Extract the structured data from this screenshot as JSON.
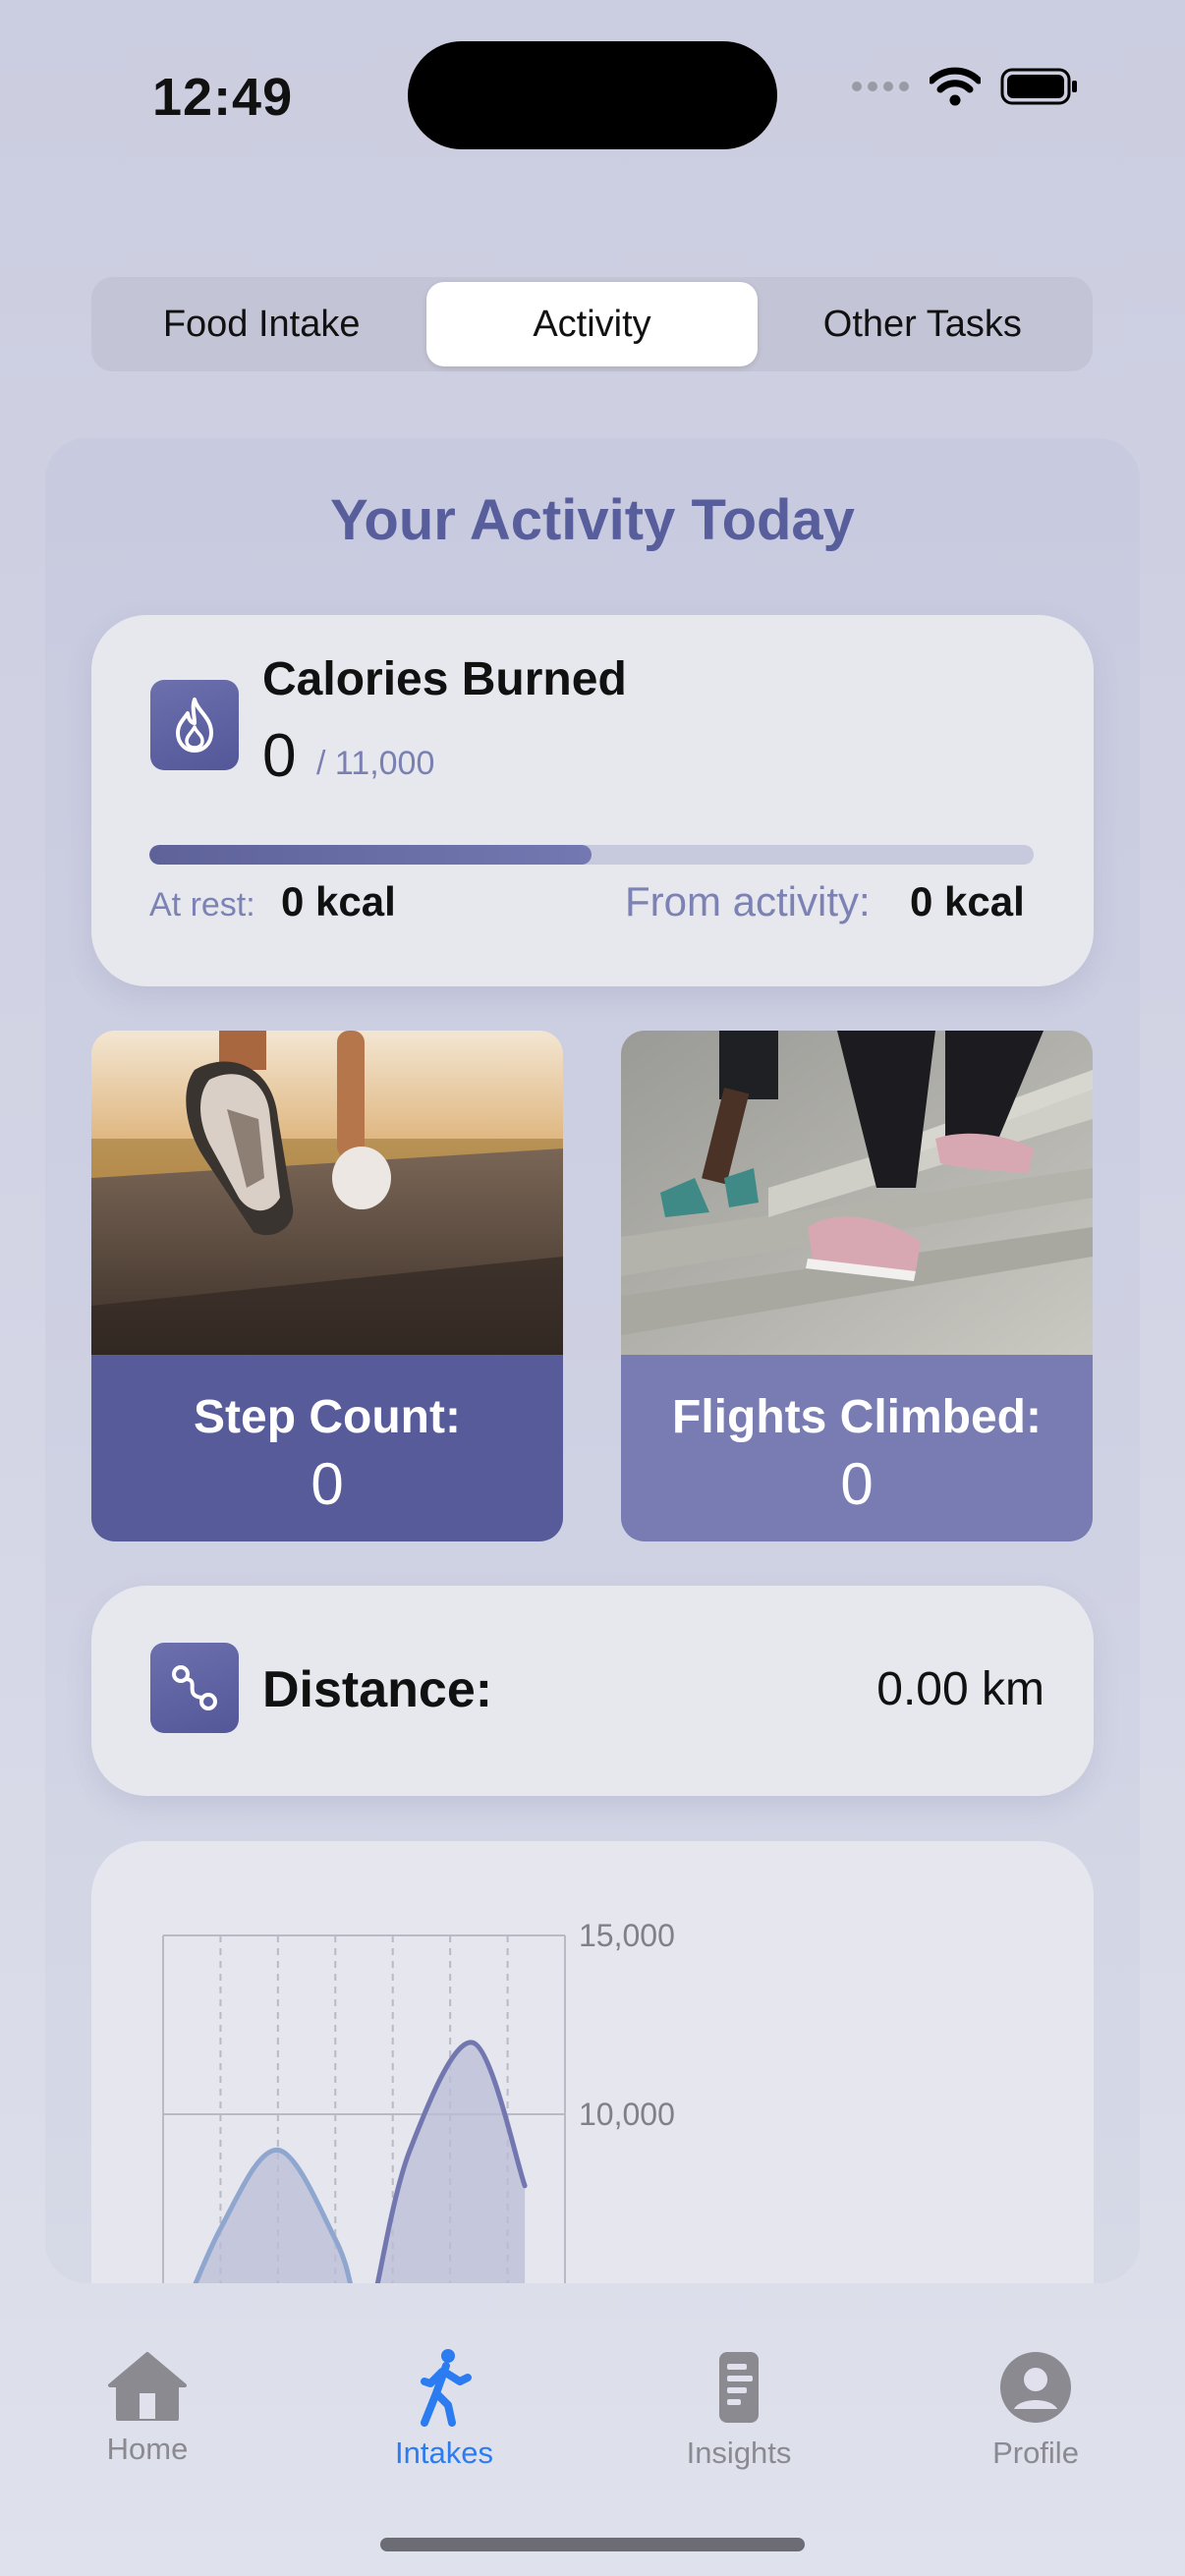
{
  "status_bar": {
    "time": "12:49"
  },
  "segments": [
    {
      "label": "Food Intake",
      "active": false
    },
    {
      "label": "Activity",
      "active": true
    },
    {
      "label": "Other Tasks",
      "active": false
    }
  ],
  "panel": {
    "title": "Your Activity Today"
  },
  "calories": {
    "title": "Calories Burned",
    "value": "0",
    "goal": "/ 11,000",
    "progress_fraction": 0.5,
    "at_rest_label": "At rest:",
    "at_rest_value": "0 kcal",
    "from_activity_label": "From activity:",
    "from_activity_value": "0 kcal"
  },
  "steps": {
    "label": "Step Count:",
    "value": "0"
  },
  "flights": {
    "label": "Flights Climbed:",
    "value": "0"
  },
  "distance": {
    "label": "Distance:",
    "value": "0.00 km"
  },
  "chart_data": {
    "type": "area",
    "y_ticks": [
      "15,000",
      "10,000"
    ],
    "grid": true,
    "series": [
      {
        "x": [
          0.0,
          1.0,
          2.0,
          3.0,
          3.3
        ],
        "values": [
          3000,
          6800,
          9000,
          6500,
          5000
        ]
      },
      {
        "x": [
          3.7,
          4.3,
          5.4,
          6.3
        ],
        "values": [
          5000,
          9000,
          12000,
          8000
        ]
      }
    ],
    "ylim": [
      5000,
      15000
    ]
  },
  "tabs": [
    {
      "label": "Home",
      "icon": "house-icon",
      "active": false
    },
    {
      "label": "Intakes",
      "icon": "walking-figure-icon",
      "active": true
    },
    {
      "label": "Insights",
      "icon": "document-icon",
      "active": false
    },
    {
      "label": "Profile",
      "icon": "person-circle-icon",
      "active": false
    }
  ],
  "colors": {
    "accent": "#575e9b",
    "tab_active": "#2c7cf1"
  }
}
